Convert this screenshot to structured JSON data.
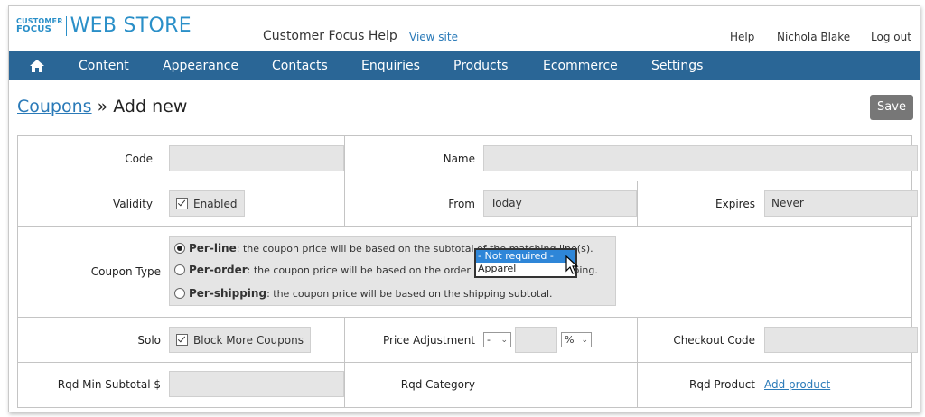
{
  "brand": {
    "logo_small_1": "CUSTOMER",
    "logo_small_2": "FOCUS",
    "logo_big": "WEB STORE",
    "color": "#2a8fc8"
  },
  "header": {
    "site_name": "Customer Focus Help",
    "view_site": "View site",
    "help": "Help",
    "user": "Nichola Blake",
    "logout": "Log out"
  },
  "nav": {
    "home_icon": "home-icon",
    "items": [
      "Content",
      "Appearance",
      "Contacts",
      "Enquiries",
      "Products",
      "Ecommerce",
      "Settings"
    ],
    "bg_color": "#2a6696"
  },
  "page": {
    "breadcrumb_link": "Coupons",
    "title_rest": " » Add new",
    "save_label": "Save"
  },
  "form": {
    "code_label": "Code",
    "code_value": "",
    "name_label": "Name",
    "name_value": "",
    "validity_label": "Validity",
    "enabled_label": "Enabled",
    "from_label": "From",
    "from_value": "Today",
    "expires_label": "Expires",
    "expires_value": "Never",
    "coupon_type_label": "Coupon Type",
    "coupon_types": [
      {
        "name": "Per-line",
        "desc": ": the coupon price will be based on the subtotal of the matching line(s).",
        "selected": true
      },
      {
        "name": "Per-order",
        "desc": ": the coupon price will be based on the order subtotal before shipping.",
        "selected": false
      },
      {
        "name": "Per-shipping",
        "desc": ": the coupon price will be based on the shipping subtotal.",
        "selected": false
      }
    ],
    "solo_label": "Solo",
    "block_label": "Block More Coupons",
    "price_adj_label": "Price Adjustment",
    "price_sign": "-",
    "price_value": "",
    "price_unit": "%",
    "checkout_label": "Checkout Code",
    "checkout_value": "",
    "min_subtotal_label": "Rqd Min Subtotal $",
    "min_subtotal_value": "",
    "category_label": "Rqd Category",
    "category_options": [
      "- Not required -",
      "Apparel"
    ],
    "product_label": "Rqd Product",
    "add_product": "Add product"
  }
}
